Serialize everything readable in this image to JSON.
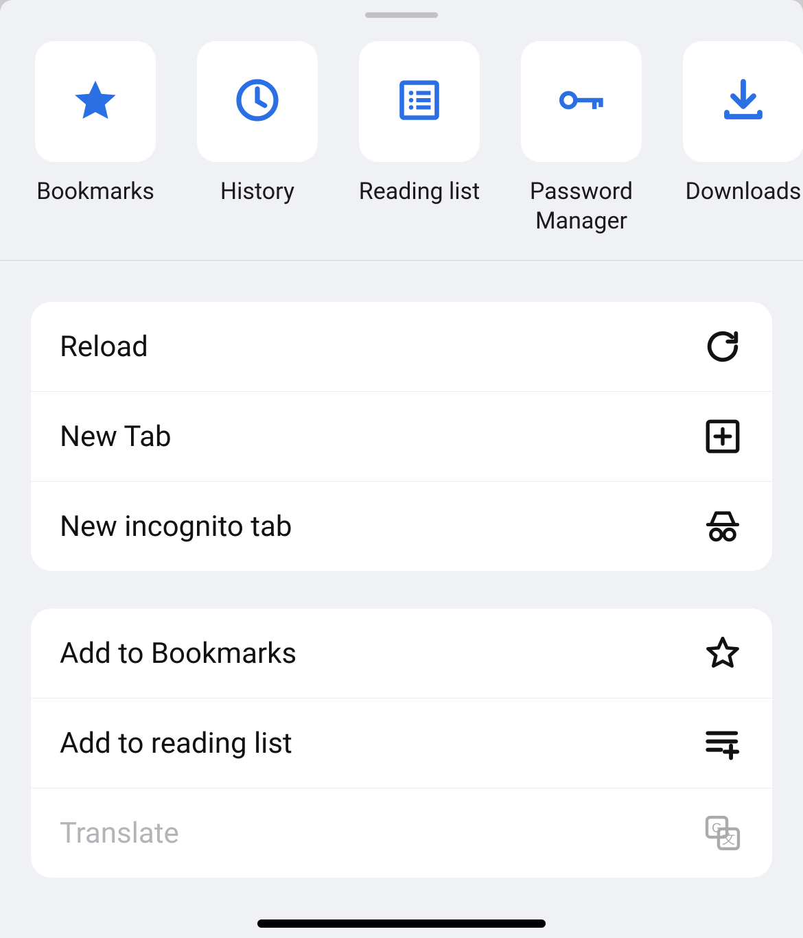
{
  "colors": {
    "accent": "#2b6fe4",
    "sheet_bg": "#f0f1f5",
    "tile_bg": "#ffffff",
    "text": "#1a1a1a",
    "disabled_text": "#b3b3b8"
  },
  "shortcuts": [
    {
      "id": "bookmarks",
      "label": "Bookmarks",
      "icon": "star-filled-icon"
    },
    {
      "id": "history",
      "label": "History",
      "icon": "clock-icon"
    },
    {
      "id": "reading-list",
      "label": "Reading list",
      "icon": "list-card-icon"
    },
    {
      "id": "password-manager",
      "label": "Password Manager",
      "icon": "key-icon"
    },
    {
      "id": "downloads",
      "label": "Downloads",
      "icon": "download-icon"
    }
  ],
  "menu_groups": [
    {
      "items": [
        {
          "id": "reload",
          "label": "Reload",
          "icon": "reload-icon",
          "enabled": true
        },
        {
          "id": "new-tab",
          "label": "New Tab",
          "icon": "plus-square-icon",
          "enabled": true
        },
        {
          "id": "new-incognito-tab",
          "label": "New incognito tab",
          "icon": "incognito-icon",
          "enabled": true
        }
      ]
    },
    {
      "items": [
        {
          "id": "add-to-bookmarks",
          "label": "Add to Bookmarks",
          "icon": "star-outline-icon",
          "enabled": true
        },
        {
          "id": "add-to-reading-list",
          "label": "Add to reading list",
          "icon": "list-add-icon",
          "enabled": true
        },
        {
          "id": "translate",
          "label": "Translate",
          "icon": "translate-icon",
          "enabled": false
        }
      ]
    }
  ]
}
